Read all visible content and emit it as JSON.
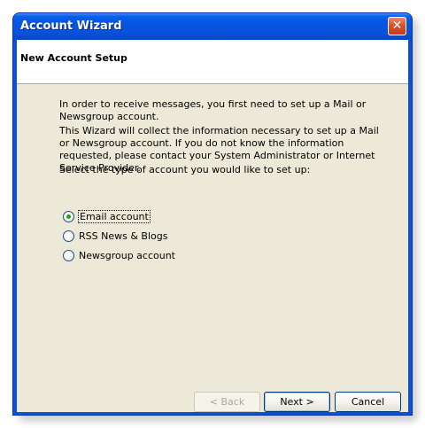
{
  "window": {
    "title": "Account Wizard",
    "close_glyph": "✕"
  },
  "header": {
    "title": "New Account Setup"
  },
  "intro": {
    "paragraph1": "In order to receive messages, you first need to set up a Mail or Newsgroup account.",
    "paragraph2": "This Wizard will collect the information necessary to set up a Mail or Newsgroup account. If you do not know the information requested, please contact your System Administrator or Internet Service Provider.",
    "prompt": "Select the type of account you would like to set up:"
  },
  "account_types": [
    {
      "label": "Email account",
      "selected": true
    },
    {
      "label": "RSS News & Blogs",
      "selected": false
    },
    {
      "label": "Newsgroup account",
      "selected": false
    }
  ],
  "buttons": {
    "back": "< Back",
    "next": "Next >",
    "cancel": "Cancel"
  },
  "colors": {
    "titlebar": "#0554e3",
    "dialog_bg": "#ece9d8",
    "close_button": "#d9512f",
    "radio_check": "#21a121"
  }
}
